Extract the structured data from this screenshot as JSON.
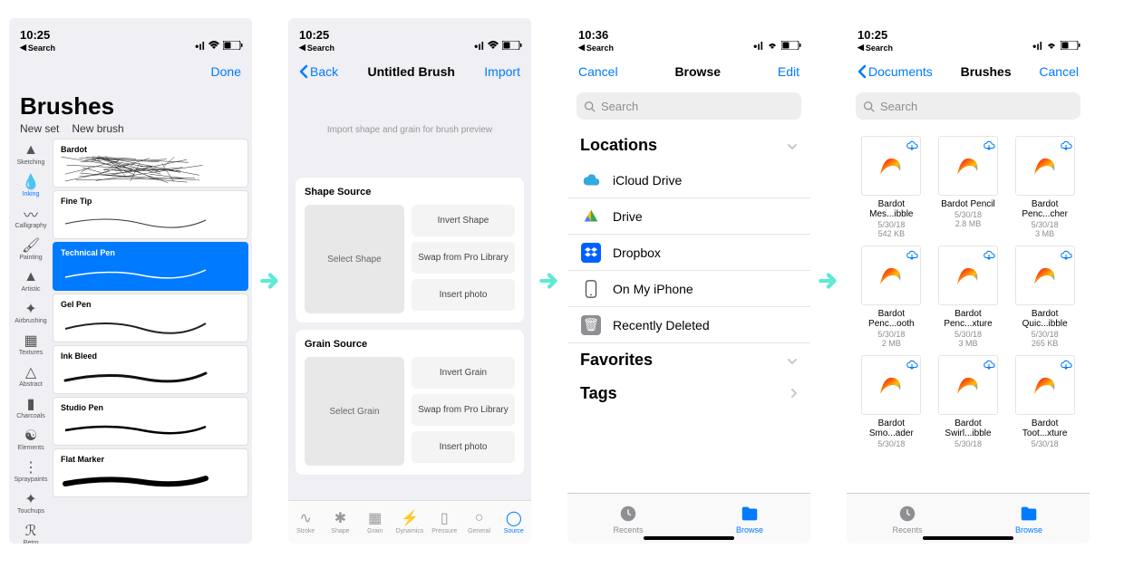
{
  "status": {
    "time1": "10:25",
    "time2": "10:36",
    "back": "Search"
  },
  "s1": {
    "done": "Done",
    "title": "Brushes",
    "new_set": "New set",
    "new_brush": "New brush",
    "cats": [
      "Sketching",
      "Inking",
      "Calligraphy",
      "Painting",
      "Artistic",
      "Airbrushing",
      "Textures",
      "Abstract",
      "Charcoals",
      "Elements",
      "Spraypaints",
      "Touchups",
      "Retro"
    ],
    "active_cat": 1,
    "brushes": [
      "Bardot",
      "Fine Tip",
      "Technical Pen",
      "Gel Pen",
      "Ink Bleed",
      "Studio Pen",
      "Flat Marker"
    ],
    "selected_brush": 2
  },
  "s2": {
    "back": "Back",
    "title": "Untitled Brush",
    "import": "Import",
    "preview_hint": "Import shape and grain for brush preview",
    "shape_title": "Shape Source",
    "select_shape": "Select Shape",
    "invert_shape": "Invert Shape",
    "swap_shape": "Swap from Pro Library",
    "photo_shape": "Insert photo",
    "grain_title": "Grain Source",
    "select_grain": "Select Grain",
    "invert_grain": "Invert Grain",
    "swap_grain": "Swap from Pro Library",
    "photo_grain": "Insert photo",
    "tabs": [
      "Stroke",
      "Shape",
      "Grain",
      "Dynamics",
      "Pressure",
      "General",
      "Source"
    ]
  },
  "s3": {
    "cancel": "Cancel",
    "title": "Browse",
    "edit": "Edit",
    "search": "Search",
    "locations": "Locations",
    "rows": [
      "iCloud Drive",
      "Drive",
      "Dropbox",
      "On My iPhone",
      "Recently Deleted"
    ],
    "favorites": "Favorites",
    "tags": "Tags",
    "recents": "Recents",
    "browse": "Browse"
  },
  "s4": {
    "back": "Documents",
    "title": "Brushes",
    "cancel": "Cancel",
    "search": "Search",
    "files": [
      {
        "name": "Bardot Mes...ibble",
        "date": "5/30/18",
        "size": "542 KB"
      },
      {
        "name": "Bardot Pencil",
        "date": "5/30/18",
        "size": "2.8 MB"
      },
      {
        "name": "Bardot Penc...cher",
        "date": "5/30/18",
        "size": "3 MB"
      },
      {
        "name": "Bardot Penc...ooth",
        "date": "5/30/18",
        "size": "2 MB"
      },
      {
        "name": "Bardot Penc...xture",
        "date": "5/30/18",
        "size": "3 MB"
      },
      {
        "name": "Bardot Quic...ibble",
        "date": "5/30/18",
        "size": "265 KB"
      },
      {
        "name": "Bardot Smo...ader",
        "date": "5/30/18",
        "size": ""
      },
      {
        "name": "Bardot Swirl...ibble",
        "date": "5/30/18",
        "size": ""
      },
      {
        "name": "Bardot Toot...xture",
        "date": "5/30/18",
        "size": ""
      }
    ],
    "recents": "Recents",
    "browse": "Browse"
  }
}
